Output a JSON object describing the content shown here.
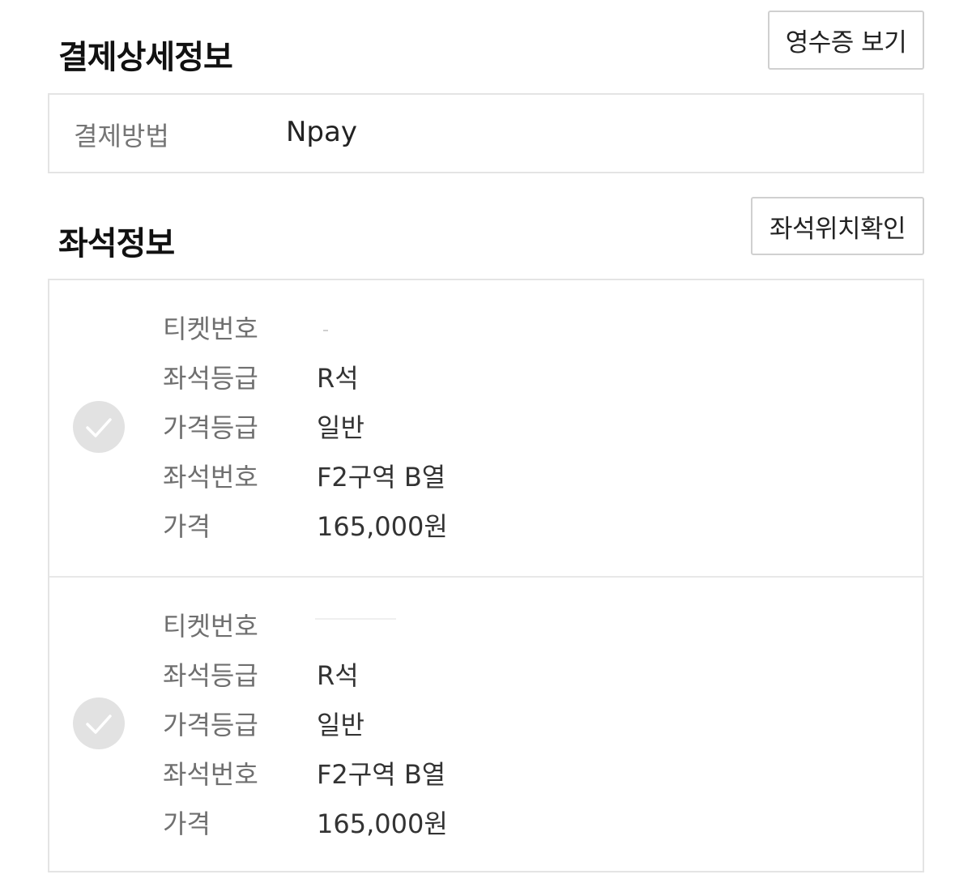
{
  "payment": {
    "title": "결제상세정보",
    "receipt_button": "영수증 보기",
    "method_label": "결제방법",
    "method_value": "Npay"
  },
  "seats": {
    "title": "좌석정보",
    "location_button": "좌석위치확인",
    "tickets": [
      {
        "ticket_no_label": "티켓번호",
        "grade_label": "좌석등급",
        "grade_value": "R석",
        "price_grade_label": "가격등급",
        "price_grade_value": "일반",
        "seat_no_label": "좌석번호",
        "seat_no_value": "F2구역 B열",
        "price_label": "가격",
        "price_value": "165,000원"
      },
      {
        "ticket_no_label": "티켓번호",
        "grade_label": "좌석등급",
        "grade_value": "R석",
        "price_grade_label": "가격등급",
        "price_grade_value": "일반",
        "seat_no_label": "좌석번호",
        "seat_no_value": "F2구역 B열",
        "price_label": "가격",
        "price_value": "165,000원"
      }
    ]
  },
  "icons": {
    "check": "check-circle-icon"
  },
  "colors": {
    "border": "#e4e4e4",
    "label_gray": "#6f6f6f",
    "check_circle": "#e2e2e2"
  }
}
